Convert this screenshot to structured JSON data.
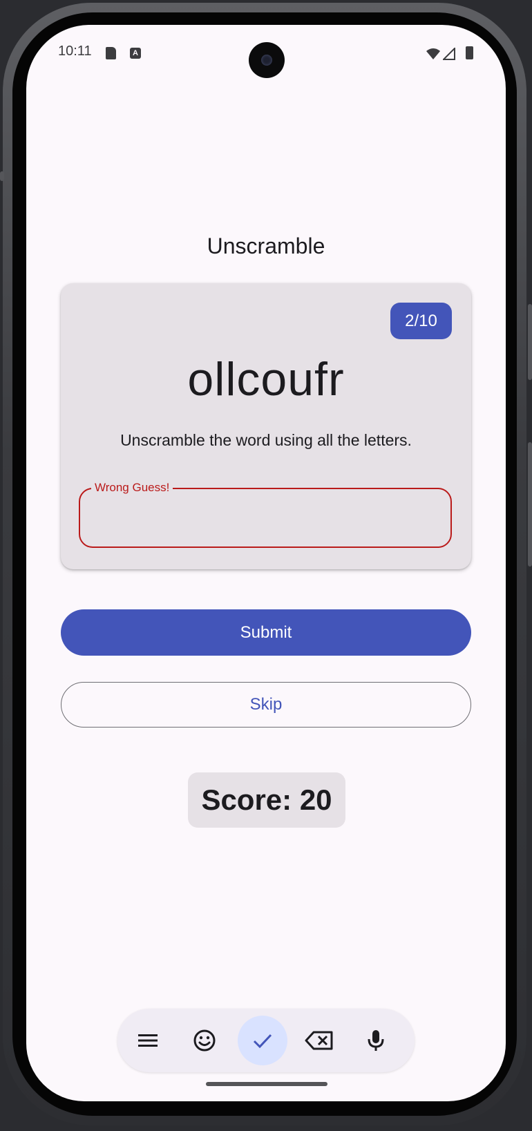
{
  "status_bar": {
    "time": "10:11",
    "icons": [
      "sim-card-icon",
      "keyboard-a-icon",
      "wifi-icon",
      "signal-icon",
      "battery-icon"
    ]
  },
  "app": {
    "title": "Unscramble"
  },
  "game_card": {
    "progress": "2/10",
    "scrambled_word": "ollcoufr",
    "instructions": "Unscramble the word using all the letters.",
    "input": {
      "label": "Wrong Guess!",
      "value": "",
      "state": "error"
    }
  },
  "buttons": {
    "submit_label": "Submit",
    "skip_label": "Skip"
  },
  "score": {
    "text": "Score: 20"
  },
  "keyboard_toolbar": {
    "items": [
      "menu-icon",
      "emoji-icon",
      "check-icon",
      "backspace-icon",
      "microphone-icon"
    ],
    "active_item": "check-icon"
  },
  "colors": {
    "primary": "#4355b9",
    "error": "#ba1a1a",
    "surface": "#fcf8fc",
    "card": "#e6e1e6",
    "on_surface": "#1c1b1f"
  }
}
